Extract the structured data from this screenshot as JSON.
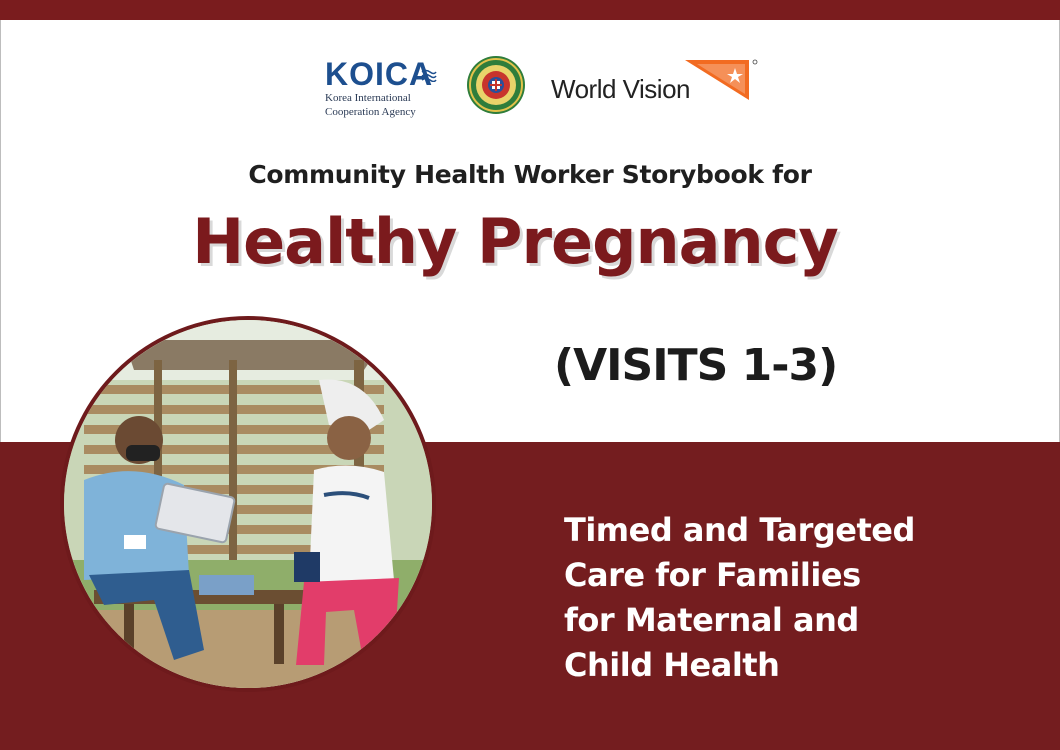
{
  "logos": {
    "koica": {
      "name": "KOICA",
      "subtitle_line1": "Korea International",
      "subtitle_line2": "Cooperation Agency"
    },
    "world_vision": {
      "name": "World Vision"
    }
  },
  "header": {
    "subtitle": "Community Health Worker Storybook for",
    "title": "Healthy Pregnancy",
    "visits": "(VISITS 1-3)"
  },
  "tagline": {
    "lines": [
      "Timed and Targeted",
      "Care for Families",
      "for Maternal and",
      "Child Health"
    ]
  },
  "colors": {
    "maroon": "#741d1f",
    "title_red": "#7b1a1d",
    "koica_blue": "#1d4f8f",
    "wv_orange": "#f26b21"
  }
}
